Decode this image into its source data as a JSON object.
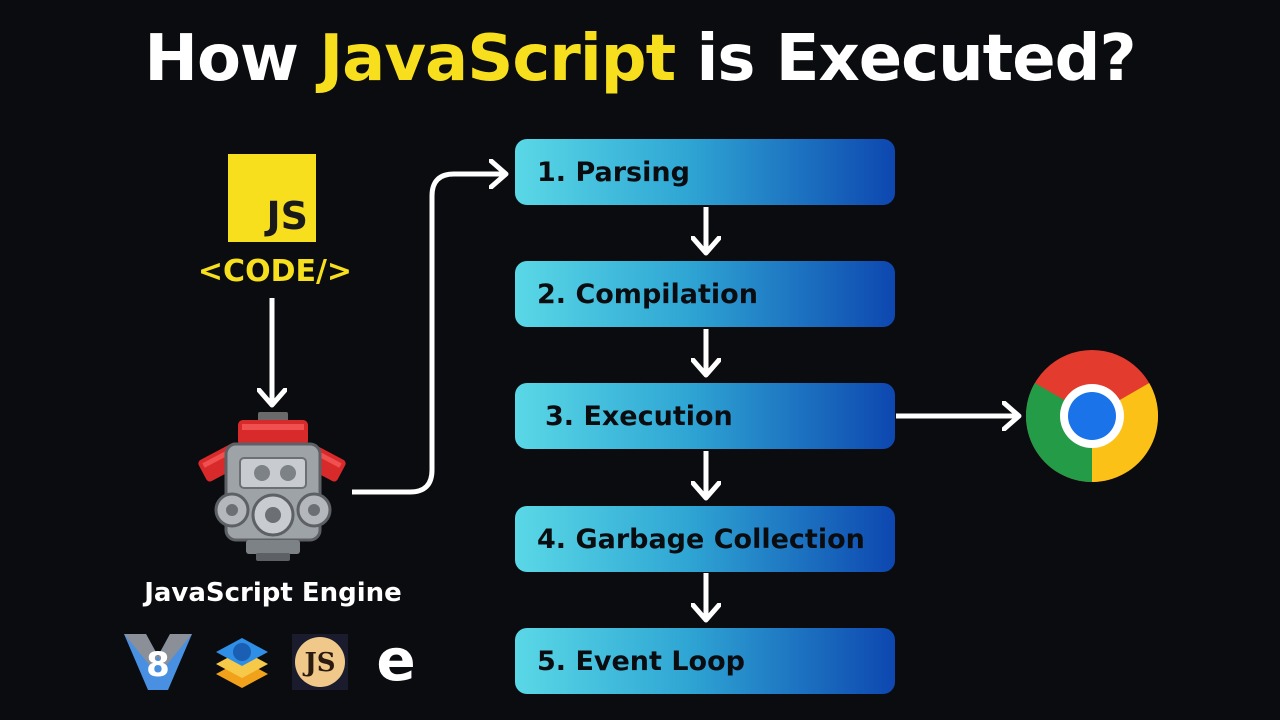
{
  "title": {
    "prefix": "How ",
    "accent": "JavaScript",
    "suffix": " is Executed?"
  },
  "js_logo": {
    "text": "JS"
  },
  "code_tag": "<CODE/>",
  "engine": {
    "label": "JavaScript Engine"
  },
  "steps": [
    {
      "label": "1. Parsing"
    },
    {
      "label": "2. Compilation"
    },
    {
      "label": "3. Execution"
    },
    {
      "label": "4. Garbage Collection"
    },
    {
      "label": "5. Event Loop"
    }
  ],
  "engine_logos": [
    "v8-icon",
    "javascriptcore-icon",
    "spidermonkey-icon",
    "chakra-edge-icon"
  ],
  "browser": "chrome-icon",
  "colors": {
    "accent": "#f7df1e",
    "background": "#0b0c10",
    "step_start": "#5ad8e6",
    "step_end": "#0d47b0"
  }
}
